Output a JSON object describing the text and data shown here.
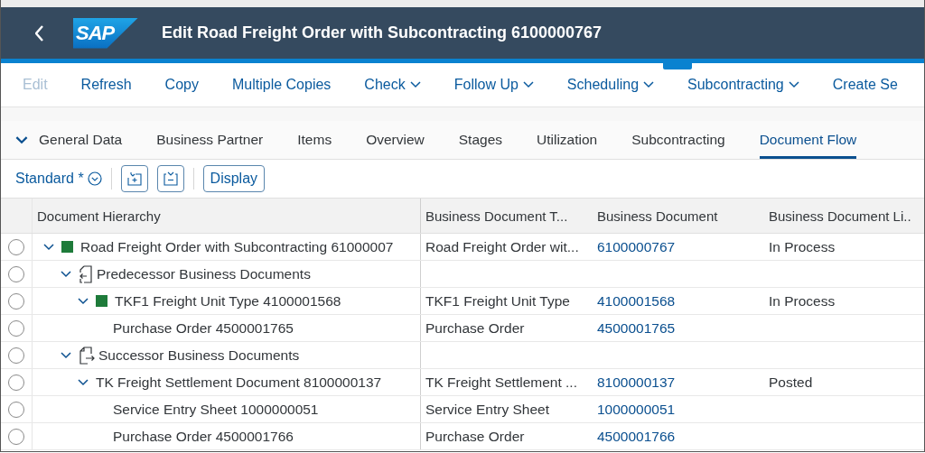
{
  "shell": {
    "logo": "SAP",
    "title": "Edit Road Freight Order with Subcontracting 6100000767"
  },
  "toolbar": [
    {
      "label": "Edit",
      "disabled": true,
      "menu": false
    },
    {
      "label": "Refresh",
      "disabled": false,
      "menu": false
    },
    {
      "label": "Copy",
      "disabled": false,
      "menu": false
    },
    {
      "label": "Multiple Copies",
      "disabled": false,
      "menu": false
    },
    {
      "label": "Check",
      "disabled": false,
      "menu": true
    },
    {
      "label": "Follow Up",
      "disabled": false,
      "menu": true
    },
    {
      "label": "Scheduling",
      "disabled": false,
      "menu": true
    },
    {
      "label": "Subcontracting",
      "disabled": false,
      "menu": true
    },
    {
      "label": "Create Se",
      "disabled": false,
      "menu": false
    }
  ],
  "tabs": [
    {
      "label": "General Data",
      "selected": false
    },
    {
      "label": "Business Partner",
      "selected": false
    },
    {
      "label": "Items",
      "selected": false
    },
    {
      "label": "Overview",
      "selected": false
    },
    {
      "label": "Stages",
      "selected": false
    },
    {
      "label": "Utilization",
      "selected": false
    },
    {
      "label": "Subcontracting",
      "selected": false
    },
    {
      "label": "Document Flow",
      "selected": true
    }
  ],
  "table_toolbar": {
    "variant": "Standard *",
    "display_button": "Display"
  },
  "table": {
    "columns": [
      "Document Hierarchy",
      "Business Document T...",
      "Business Document",
      "Business Document Li.."
    ],
    "rows": [
      {
        "color": "#1e7b3a",
        "expanded": true,
        "label": "Road Freight Order with Subcontracting 61000007",
        "type": "Road Freight Order wit...",
        "document": "6100000767",
        "lifecycle": "In Process",
        "selected": false,
        "children": [
          {
            "kind": "predecessors",
            "expanded": true,
            "label": "Predecessor Business Documents",
            "selected": false,
            "children": [
              {
                "color": "#1e7b3a",
                "expanded": true,
                "label": "TKF1 Freight Unit Type 4100001568",
                "type": "TKF1 Freight Unit Type",
                "document": "4100001568",
                "lifecycle": "In Process",
                "selected": false,
                "children": [
                  {
                    "label": "Purchase Order 4500001765",
                    "type": "Purchase Order",
                    "document": "4500001765",
                    "selected": false
                  }
                ]
              }
            ]
          },
          {
            "kind": "successors",
            "expanded": true,
            "label": "Successor Business Documents",
            "selected": false,
            "children": [
              {
                "expanded": true,
                "label": "TK Freight Settlement Document 8100000137",
                "type": "TK Freight Settlement ...",
                "document": "8100000137",
                "lifecycle": "Posted",
                "selected": false,
                "children": [
                  {
                    "label": "Service Entry Sheet 1000000051",
                    "type": "Service Entry Sheet",
                    "document": "1000000051",
                    "selected": false
                  },
                  {
                    "label": "Purchase Order 4500001766",
                    "type": "Purchase Order",
                    "document": "4500001766",
                    "selected": false
                  }
                ]
              }
            ]
          }
        ]
      }
    ]
  }
}
